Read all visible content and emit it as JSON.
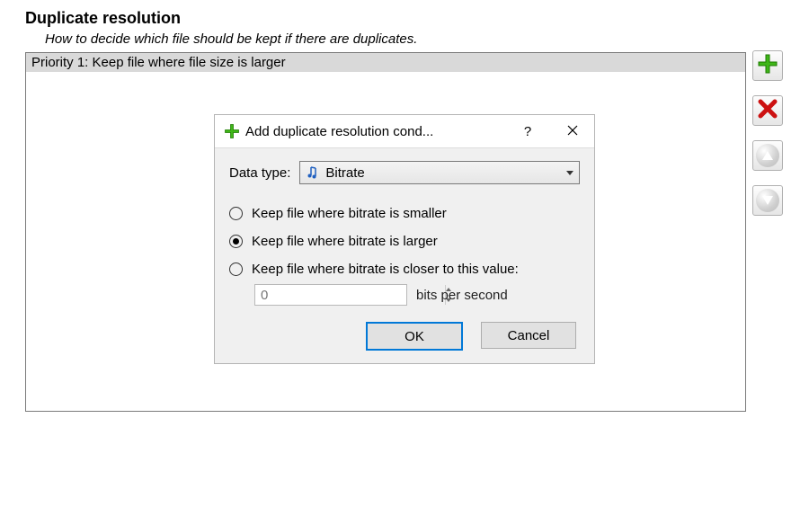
{
  "section": {
    "title": "Duplicate resolution",
    "subtitle": "How to decide which file should be kept if there are duplicates."
  },
  "rules": [
    {
      "label": "Priority 1: Keep file where file size is larger"
    }
  ],
  "sideButtons": {
    "add": "add-icon",
    "delete": "delete-icon",
    "up": "up-icon",
    "down": "down-icon"
  },
  "dialog": {
    "title": "Add duplicate resolution cond...",
    "helpGlyph": "?",
    "closeGlyph": "✕",
    "dataTypeLabel": "Data type:",
    "dataTypeValue": "Bitrate",
    "options": {
      "smaller": "Keep file where bitrate is smaller",
      "larger": "Keep file where bitrate is larger",
      "closer": "Keep file where bitrate is closer to this value:"
    },
    "selectedOption": "larger",
    "spinValue": "0",
    "unit": "bits per second",
    "ok": "OK",
    "cancel": "Cancel"
  }
}
